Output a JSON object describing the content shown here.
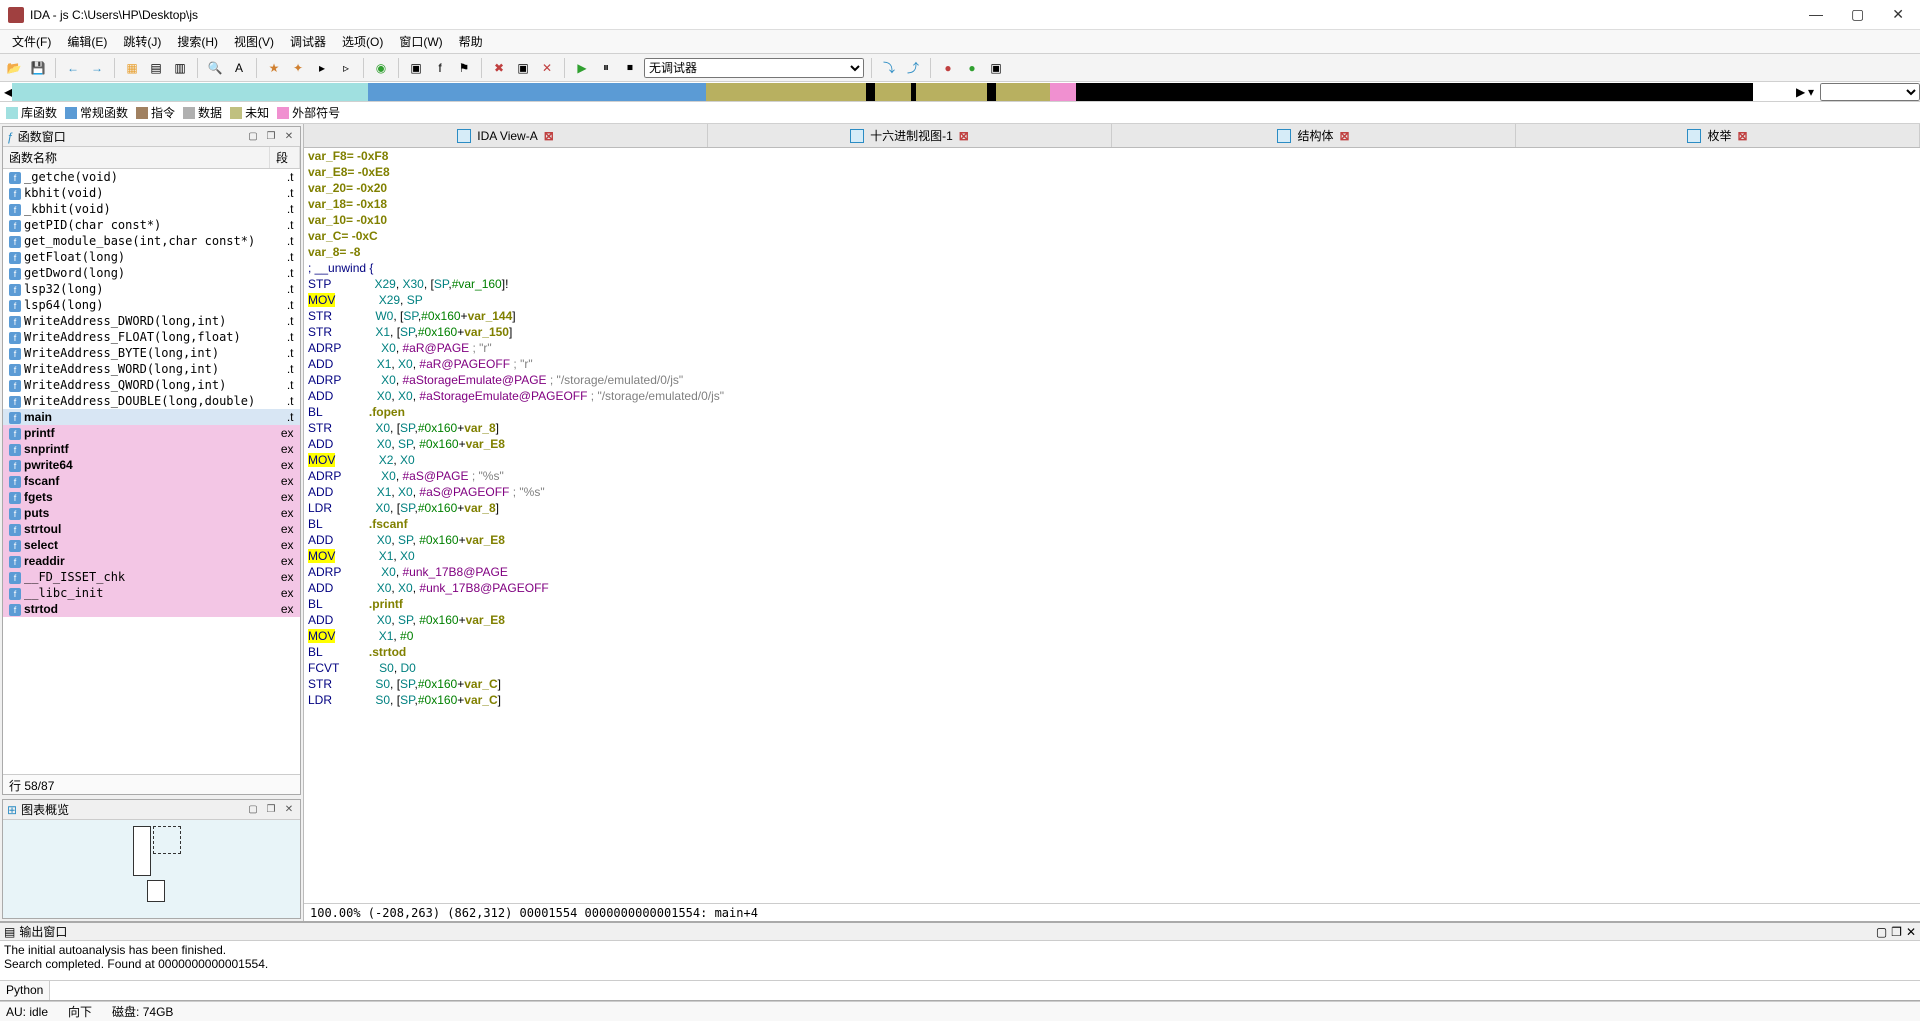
{
  "window": {
    "title": "IDA - js C:\\Users\\HP\\Desktop\\js"
  },
  "menu": [
    "文件(F)",
    "编辑(E)",
    "跳转(J)",
    "搜索(H)",
    "视图(V)",
    "调试器",
    "选项(O)",
    "窗口(W)",
    "帮助"
  ],
  "debugger_select": "无调试器",
  "legend": [
    {
      "color": "#a0e0e0",
      "label": "库函数"
    },
    {
      "color": "#5b9bd5",
      "label": "常规函数"
    },
    {
      "color": "#a08060",
      "label": "指令"
    },
    {
      "color": "#b0b0b0",
      "label": "数据"
    },
    {
      "color": "#c0c080",
      "label": "未知"
    },
    {
      "color": "#f090d0",
      "label": "外部符号"
    }
  ],
  "segments": [
    {
      "color": "#a0e0e0",
      "width": 20
    },
    {
      "color": "#5b9bd5",
      "width": 19
    },
    {
      "color": "#b8b060",
      "width": 9
    },
    {
      "color": "#000000",
      "width": 0.5
    },
    {
      "color": "#b8b060",
      "width": 2
    },
    {
      "color": "#000000",
      "width": 0.3
    },
    {
      "color": "#b8b060",
      "width": 4
    },
    {
      "color": "#000000",
      "width": 0.5
    },
    {
      "color": "#b8b060",
      "width": 3
    },
    {
      "color": "#f090d0",
      "width": 1.5
    },
    {
      "color": "#000000",
      "width": 38
    }
  ],
  "func_panel": {
    "title": "函数窗口",
    "col_name": "函数名称",
    "col_seg": "段",
    "footer": "行 58/87"
  },
  "functions": [
    {
      "name": "_getche(void)",
      "seg": ".t",
      "pink": false
    },
    {
      "name": "kbhit(void)",
      "seg": ".t",
      "pink": false
    },
    {
      "name": "_kbhit(void)",
      "seg": ".t",
      "pink": false
    },
    {
      "name": "getPID(char const*)",
      "seg": ".t",
      "pink": false
    },
    {
      "name": "get_module_base(int,char const*)",
      "seg": ".t",
      "pink": false
    },
    {
      "name": "getFloat(long)",
      "seg": ".t",
      "pink": false
    },
    {
      "name": "getDword(long)",
      "seg": ".t",
      "pink": false
    },
    {
      "name": "lsp32(long)",
      "seg": ".t",
      "pink": false
    },
    {
      "name": "lsp64(long)",
      "seg": ".t",
      "pink": false
    },
    {
      "name": "WriteAddress_DWORD(long,int)",
      "seg": ".t",
      "pink": false
    },
    {
      "name": "WriteAddress_FLOAT(long,float)",
      "seg": ".t",
      "pink": false
    },
    {
      "name": "WriteAddress_BYTE(long,int)",
      "seg": ".t",
      "pink": false
    },
    {
      "name": "WriteAddress_WORD(long,int)",
      "seg": ".t",
      "pink": false
    },
    {
      "name": "WriteAddress_QWORD(long,int)",
      "seg": ".t",
      "pink": false
    },
    {
      "name": "WriteAddress_DOUBLE(long,double)",
      "seg": ".t",
      "pink": false
    },
    {
      "name": "main",
      "seg": ".t",
      "pink": false,
      "main": true,
      "bold": true
    },
    {
      "name": "printf",
      "seg": "ex",
      "pink": true,
      "bold": true
    },
    {
      "name": "snprintf",
      "seg": "ex",
      "pink": true,
      "bold": true
    },
    {
      "name": "pwrite64",
      "seg": "ex",
      "pink": true,
      "bold": true
    },
    {
      "name": "fscanf",
      "seg": "ex",
      "pink": true,
      "bold": true
    },
    {
      "name": "fgets",
      "seg": "ex",
      "pink": true,
      "bold": true
    },
    {
      "name": "puts",
      "seg": "ex",
      "pink": true,
      "bold": true
    },
    {
      "name": "strtoul",
      "seg": "ex",
      "pink": true,
      "bold": true
    },
    {
      "name": "select",
      "seg": "ex",
      "pink": true,
      "bold": true
    },
    {
      "name": "readdir",
      "seg": "ex",
      "pink": true,
      "bold": true
    },
    {
      "name": "__FD_ISSET_chk",
      "seg": "ex",
      "pink": true
    },
    {
      "name": "__libc_init",
      "seg": "ex",
      "pink": true
    },
    {
      "name": "strtod",
      "seg": "ex",
      "pink": true,
      "bold": true
    }
  ],
  "graph_panel": {
    "title": "图表概览"
  },
  "tabs": [
    {
      "label": "IDA View-A",
      "close": true
    },
    {
      "label": "十六进制视图-1",
      "close": true
    },
    {
      "label": "结构体",
      "close": true
    },
    {
      "label": "枚举",
      "close": true
    }
  ],
  "disasm_status": "100.00% (-208,263) (862,312) 00001554 0000000000001554: main+4",
  "output": {
    "title": "输出窗口",
    "lines": [
      "The initial autoanalysis has been finished.",
      "Search completed. Found at 0000000000001554."
    ],
    "input_label": "Python"
  },
  "status": {
    "au": "AU:  idle",
    "dir": "向下",
    "disk": "磁盘: 74GB"
  }
}
